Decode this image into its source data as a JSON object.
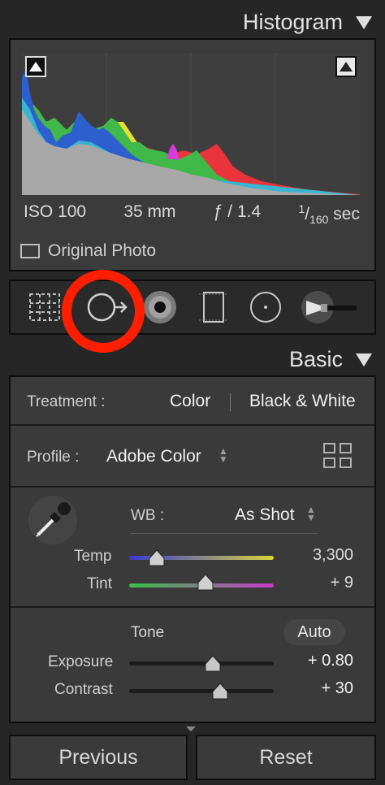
{
  "histogram": {
    "title": "Histogram",
    "iso": "ISO 100",
    "focal_length": "35 mm",
    "aperture": "ƒ / 1.4",
    "shutter_num": "1",
    "shutter_den": "160",
    "shutter_unit": "sec",
    "original_photo_label": "Original Photo",
    "original_photo_checked": false
  },
  "tools": [
    "crop-overlay-icon",
    "spot-removal-icon",
    "red-eye-icon",
    "graduated-filter-icon",
    "radial-filter-icon",
    "adjustment-brush-icon"
  ],
  "basic": {
    "title": "Basic",
    "treatment_label": "Treatment :",
    "treatment_color": "Color",
    "treatment_bw": "Black & White",
    "profile_label": "Profile :",
    "profile_value": "Adobe Color",
    "wb_label": "WB :",
    "wb_value": "As Shot",
    "temp_label": "Temp",
    "temp_value": "3,300",
    "temp_fraction": 0.19,
    "tint_label": "Tint",
    "tint_value": "+ 9",
    "tint_fraction": 0.53,
    "tone_label": "Tone",
    "auto_label": "Auto",
    "exposure_label": "Exposure",
    "exposure_value": "+ 0.80",
    "exposure_fraction": 0.58,
    "contrast_label": "Contrast",
    "contrast_value": "+ 30",
    "contrast_fraction": 0.63
  },
  "footer": {
    "previous_label": "Previous",
    "reset_label": "Reset"
  },
  "colors": {
    "highlight_ring": "#ff1f00",
    "panel_bg": "#3a3a3a"
  }
}
